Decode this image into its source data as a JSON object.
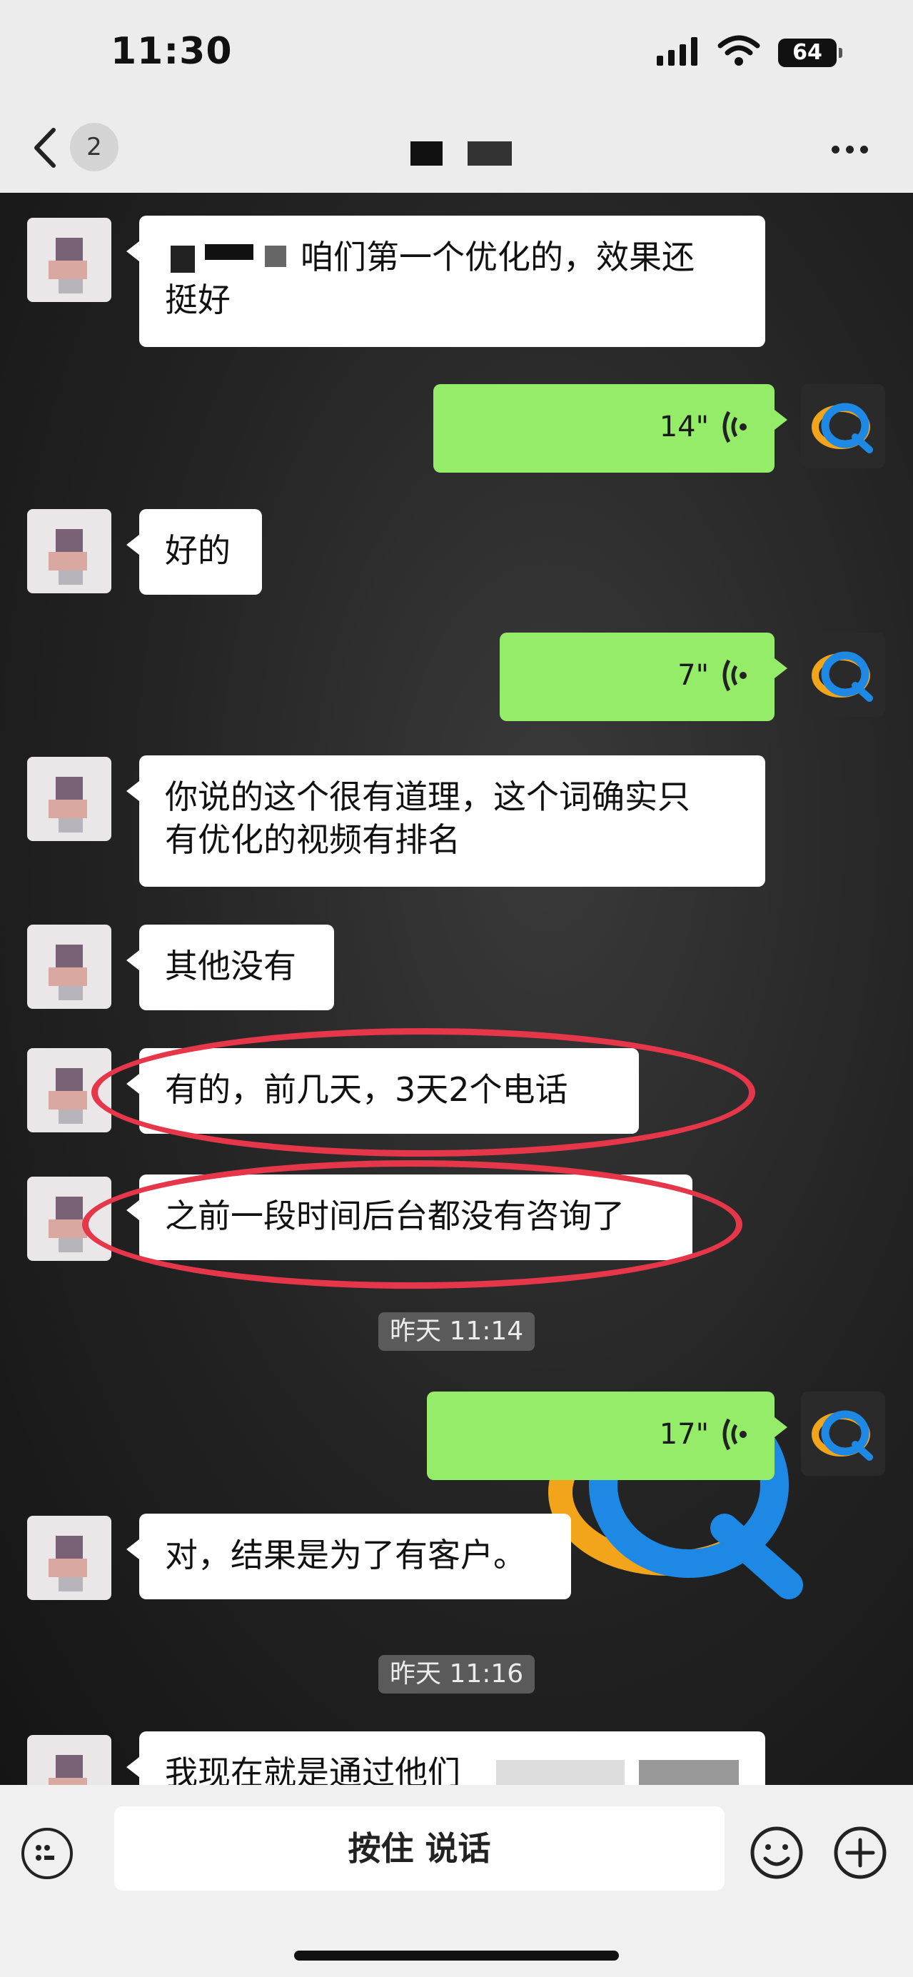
{
  "status": {
    "time": "11:30",
    "battery": "64"
  },
  "nav": {
    "unread_badge": "2"
  },
  "messages": [
    {
      "dir": "in",
      "text": "咱们第一个优化的，效果还"
    },
    {
      "dir": "in",
      "text": "挺好"
    },
    {
      "dir": "out",
      "duration": "14\""
    },
    {
      "dir": "in",
      "text": "好的"
    },
    {
      "dir": "out",
      "duration": "7\""
    },
    {
      "dir": "in",
      "text": "你说的这个很有道理，这个词确实只"
    },
    {
      "dir": "in",
      "text": "有优化的视频有排名"
    },
    {
      "dir": "in",
      "text": "其他没有"
    },
    {
      "dir": "in",
      "text": "有的，前几天，3天2个电话"
    },
    {
      "dir": "in",
      "text": "之前一段时间后台都没有咨询了"
    },
    {
      "dir": "out",
      "duration": "17\""
    },
    {
      "dir": "in",
      "text": "对，结果是为了有客户。"
    },
    {
      "dir": "in",
      "text": "我现在就是通过他们"
    }
  ],
  "timestamps": [
    "昨天 11:14",
    "昨天 11:16"
  ],
  "input": {
    "talk_label": "按住 说话"
  },
  "colors": {
    "outgoing_bubble": "#95ec69",
    "incoming_bubble": "#ffffff",
    "highlight_circle": "#e5364a"
  },
  "icons": [
    "back-icon",
    "more-icon",
    "voice-wave-icon",
    "keyboard-voice-icon",
    "emoji-icon",
    "plus-icon"
  ]
}
